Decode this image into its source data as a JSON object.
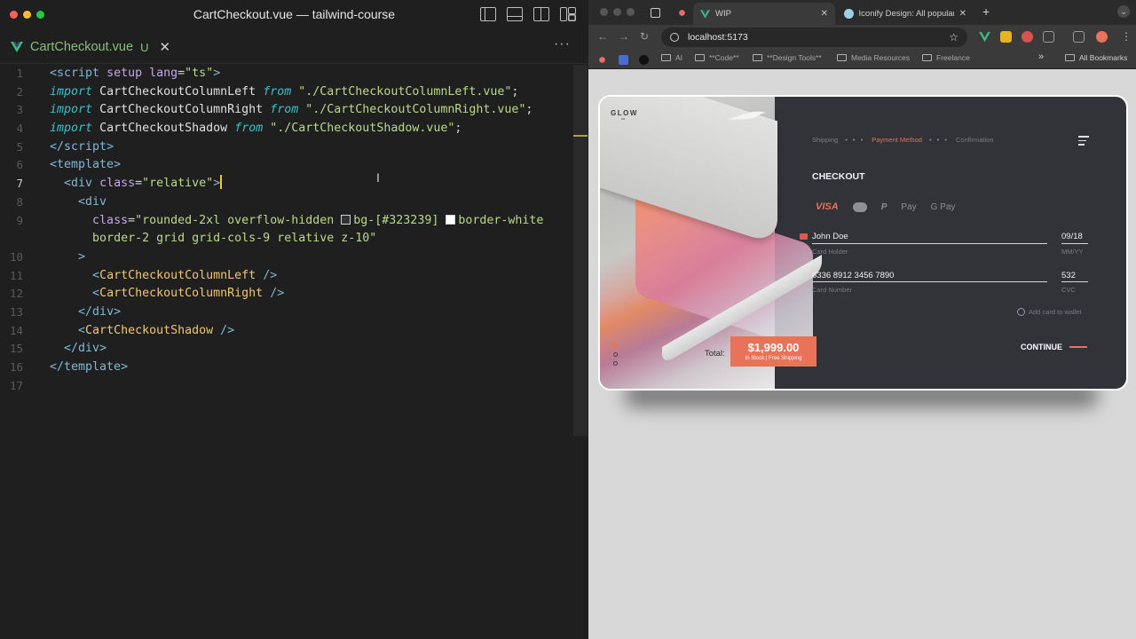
{
  "editor": {
    "window_title": "CartCheckout.vue — tailwind-course",
    "tab": {
      "name": "CartCheckout.vue",
      "status": "U"
    },
    "more": "···",
    "lines": [
      {
        "n": "1"
      },
      {
        "n": "2"
      },
      {
        "n": "3"
      },
      {
        "n": "4"
      },
      {
        "n": "5"
      },
      {
        "n": "6"
      },
      {
        "n": "7"
      },
      {
        "n": "8"
      },
      {
        "n": "9"
      },
      {
        "n": "10"
      },
      {
        "n": "11"
      },
      {
        "n": "12"
      },
      {
        "n": "13"
      },
      {
        "n": "14"
      },
      {
        "n": "15"
      },
      {
        "n": "16"
      },
      {
        "n": "17"
      }
    ],
    "code": {
      "l1_tag": "script",
      "l1_attr1": "setup",
      "l1_attr2": "lang",
      "l1_val": "\"ts\"",
      "import": "import",
      "from": "from",
      "l2_id": "CartCheckoutColumnLeft",
      "l2_path": "\"./CartCheckoutColumnLeft.vue\"",
      "l3_id": "CartCheckoutColumnRight",
      "l3_path": "\"./CartCheckoutColumnRight.vue\"",
      "l4_id": "CartCheckoutShadow",
      "l4_path": "\"./CartCheckoutShadow.vue\"",
      "l5_tag": "/script",
      "l6_tag": "template",
      "div": "div",
      "class": "class",
      "l7_val": "\"relative\"",
      "l9_val_a": "\"rounded-2xl overflow-hidden ",
      "l9_val_b": "bg-[#323239] ",
      "l9_val_c": "border-white",
      "l10_val": "border-2 grid grid-cols-9 relative z-10\"",
      "l12_comp": "CartCheckoutColumnLeft",
      "l13_comp": "CartCheckoutColumnRight",
      "l14_tag": "/div",
      "l15_comp": "CartCheckoutShadow",
      "l16_tag": "/div",
      "l17_tag": "/template"
    }
  },
  "browser": {
    "tabs": [
      {
        "label": "WIP"
      },
      {
        "label": "Iconify Design: All popular ico"
      }
    ],
    "new_tab": "+",
    "url": "localhost:5173",
    "bookmarks": [
      "AI",
      "**Code**",
      "**Design Tools**",
      "Media Resources",
      "Freelance"
    ],
    "all_bookmarks": "All Bookmarks",
    "overflow": "»"
  },
  "checkout": {
    "brand": "GLOW",
    "brand_sub": "co",
    "steps": [
      "Shipping",
      "Payment Method",
      "Confirmation"
    ],
    "step_sep": "• • •",
    "title": "CHECKOUT",
    "payment_methods": [
      "VISA",
      "PayPal",
      "Apple Pay",
      "G Pay"
    ],
    "apple_pay": " Pay",
    "paypal_glyph": "P",
    "card_holder_value": "John Doe",
    "card_holder_label": "Card Holder",
    "expiry_value": "09/18",
    "expiry_label": "MM/YY",
    "card_number_value": "6336 8912 3456 7890",
    "card_number_label": "Card Number",
    "cvc_value": "532",
    "cvc_label": "CVC",
    "wallet_label": "Add card to wallet",
    "continue_label": "CONTINUE",
    "total_label": "Total:",
    "price": "$1,999.00",
    "price_note": "In Stock | Free Shipping",
    "accent_color": "#e8725a",
    "panel_color": "#323239"
  }
}
